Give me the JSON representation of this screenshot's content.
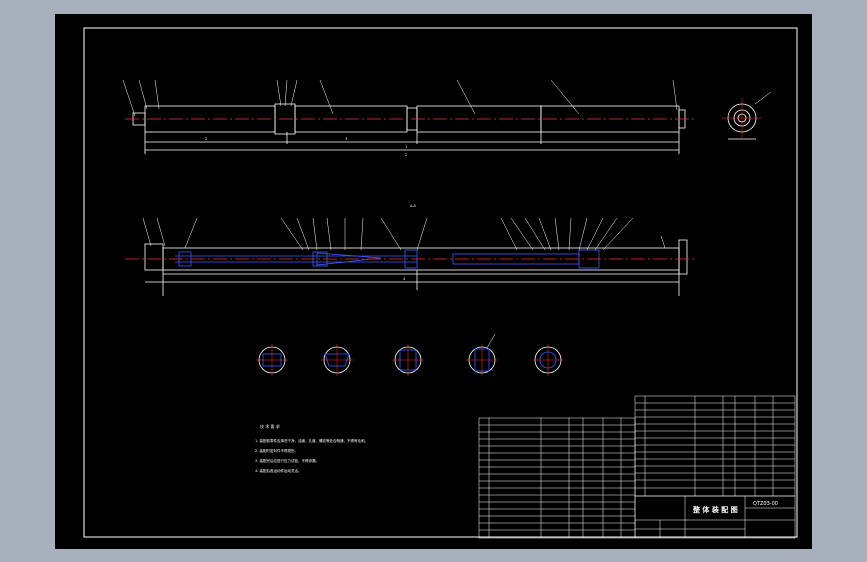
{
  "drawing": {
    "section_label": "A-A",
    "dims": {
      "top_1": "2",
      "top_2": "3",
      "overall_top": "1",
      "overall_mid": "2",
      "overall_label": "4"
    },
    "notes": {
      "title": "技 术 要 求",
      "lines": [
        "1. 装配前零件应清洗干净，油道、孔道、螺纹等处应畅通，不得有毛刺。",
        "2. 装配时密封件不得损伤。",
        "3. 装配完后应进行压力试验，不得渗漏。",
        "4. 装配后各运动件运动灵活。"
      ]
    },
    "title_block": {
      "name": "整 体 装 配 图",
      "code": "QTZ03-00"
    },
    "colors": {
      "background": "#000000",
      "frame": "#ffffff",
      "outline": "#ffffff",
      "centerline": "#ff2a2a",
      "hidden": "#3b5cff",
      "leader": "#ffffff"
    }
  }
}
